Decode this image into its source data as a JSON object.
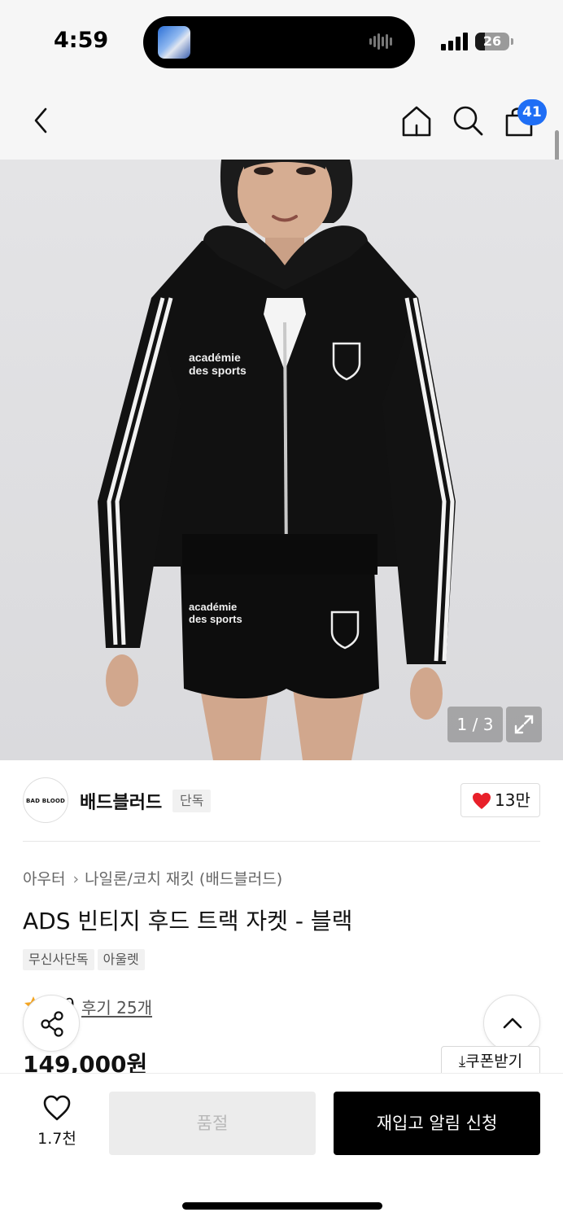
{
  "status_bar": {
    "time": "4:59",
    "battery": "26"
  },
  "nav": {
    "cart_count": "41"
  },
  "gallery": {
    "counter": "1 / 3"
  },
  "product_image": {
    "print_main": "académie\ndes sports"
  },
  "brand": {
    "logo_text": "BAD BLOOD",
    "name": "배드블러드",
    "tag": "단독",
    "likes": "13만"
  },
  "breadcrumb": {
    "category": "아우터",
    "subcategory": "나일론/코치 재킷 (배드블러드)"
  },
  "product": {
    "title": "ADS 빈티지 후드 트랙 자켓 - 블랙",
    "tags": [
      "무신사단독",
      "아울렛"
    ],
    "rating": "4.9",
    "review_text": "후기 25개",
    "price": "149,000원"
  },
  "actions": {
    "coupon_label": "쿠폰받기",
    "wish_count": "1.7천",
    "soldout_label": "품절",
    "restock_label": "재입고 알림 신청"
  },
  "colors": {
    "badge_blue": "#1f6ef5",
    "heart_red": "#e8202a",
    "star_orange": "#f5a623"
  }
}
